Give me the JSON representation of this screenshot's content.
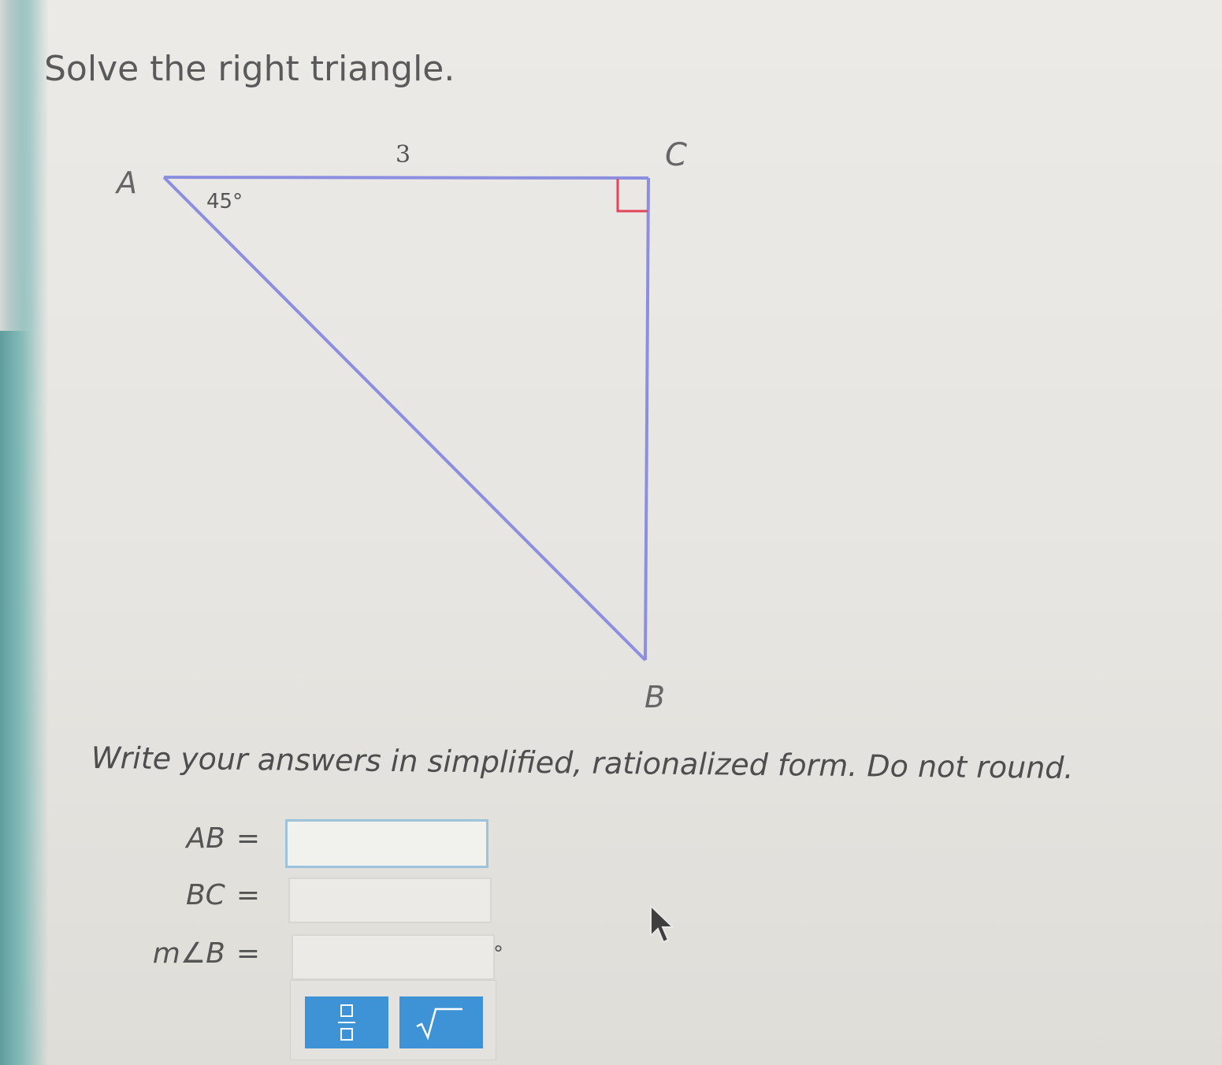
{
  "problem": {
    "title": "Solve the right triangle.",
    "instructions": "Write your answers in simplified, rationalized form. Do not round."
  },
  "figure": {
    "vertex_a": "A",
    "vertex_b": "B",
    "vertex_c": "C",
    "side_ac_length": "3",
    "angle_a": "45°",
    "line_color": "#8c8ee0",
    "right_angle_marker_color": "#e2445a"
  },
  "answers": [
    {
      "label": "AB",
      "equals": "=",
      "value": ""
    },
    {
      "label": "BC",
      "equals": "=",
      "value": ""
    },
    {
      "label": "m∠B",
      "equals": "=",
      "value": "",
      "suffix": "°"
    }
  ],
  "toolbar": {
    "fraction_icon": "fraction-icon",
    "sqrt_icon": "square-root-icon",
    "button_color": "#3d93d6"
  }
}
